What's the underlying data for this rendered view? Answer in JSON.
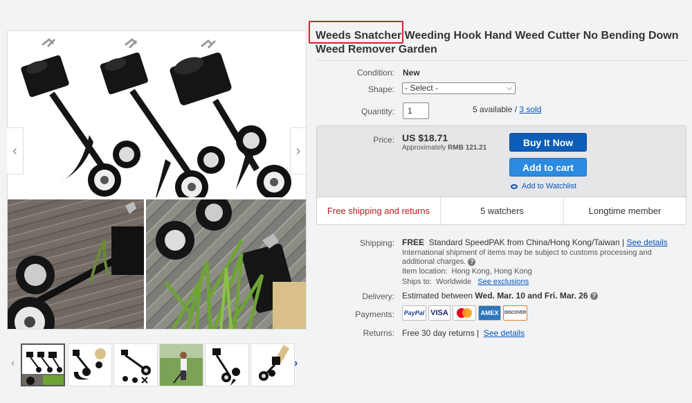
{
  "gallery": {
    "prev_arrow": "‹",
    "next_arrow": "›",
    "thumb_prev": "‹",
    "thumb_next": "›"
  },
  "title": {
    "text": "Weeds Snatcher Weeding Hook Hand Weed Cutter No Bending Down Weed Remover Garden",
    "highlight_color": "#d2232a"
  },
  "condition": {
    "label": "Condition:",
    "value": "New"
  },
  "shape": {
    "label": "Shape:",
    "selected": "- Select -"
  },
  "quantity": {
    "label": "Quantity:",
    "value": "1",
    "available": "5 available /",
    "sold": "3 sold"
  },
  "price": {
    "label": "Price:",
    "amount": "US $18.71",
    "approx_prefix": "Approximately",
    "approx_value": "RMB 121.21"
  },
  "actions": {
    "buy_now": "Buy It Now",
    "add_to_cart": "Add to cart",
    "watchlist": "Add to Watchlist",
    "buy_color": "#0c5eb8",
    "cart_color": "#2c8ae0"
  },
  "strip": {
    "shipping_returns": "Free shipping and returns",
    "watchers": "5 watchers",
    "member": "Longtime member",
    "highlight_color": "#c0161e"
  },
  "shipping": {
    "label": "Shipping:",
    "free": "FREE",
    "method": "Standard SpeedPAK from China/Hong Kong/Taiwan |",
    "details_link": "See details",
    "intl_note": "International shipment of items may be subject to customs processing and additional charges.",
    "location_label": "Item location:",
    "location": "Hong Kong, Hong Kong",
    "ships_to_label": "Ships to:",
    "ships_to": "Worldwide",
    "exclusions_link": "See exclusions"
  },
  "delivery": {
    "label": "Delivery:",
    "prefix": "Estimated between",
    "range": "Wed. Mar. 10 and Fri. Mar. 26"
  },
  "payments": {
    "label": "Payments:",
    "methods": [
      "PayPal",
      "VISA",
      "MasterCard",
      "AMEX",
      "DISCOVER"
    ]
  },
  "returns": {
    "label": "Returns:",
    "text": "Free 30 day returns |",
    "details_link": "See details"
  }
}
